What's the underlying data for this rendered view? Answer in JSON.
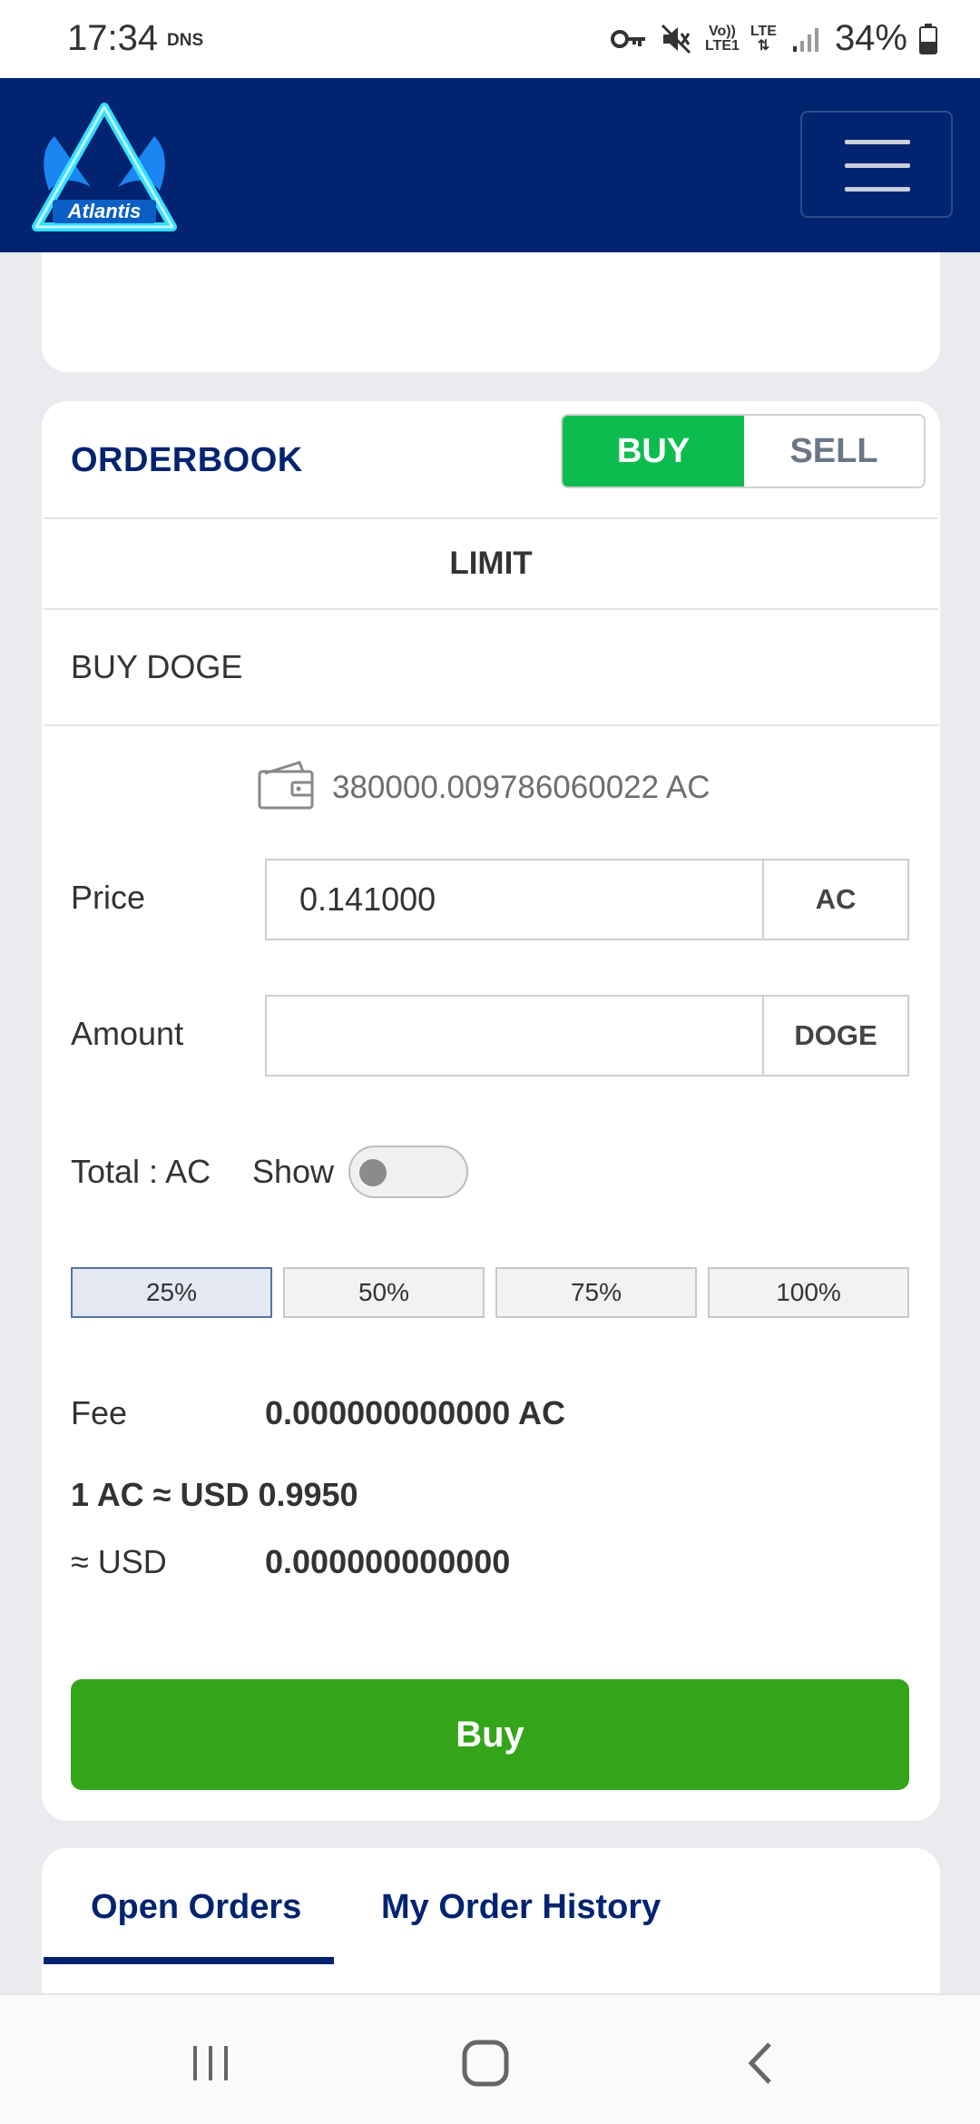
{
  "status_bar": {
    "time": "17:34",
    "carrier": "DNS",
    "volte_line1": "Vo))",
    "volte_line2": "LTE1",
    "lte_label": "LTE",
    "battery": "34%"
  },
  "header": {
    "logo_text": "Atlantis",
    "menu_icon": "hamburger-icon"
  },
  "orderbook": {
    "title": "ORDERBOOK",
    "buy_tab": "BUY",
    "sell_tab": "SELL",
    "order_type": "LIMIT",
    "pair_title": "BUY DOGE",
    "wallet_balance": "380000.009786060022 AC",
    "price_label": "Price",
    "price_value": "0.141000",
    "price_unit": "AC",
    "amount_label": "Amount",
    "amount_value": "",
    "amount_unit": "DOGE",
    "total_label": "Total : AC",
    "show_label": "Show",
    "show_toggle_on": false,
    "percent_buttons": [
      "25%",
      "50%",
      "75%",
      "100%"
    ],
    "selected_percent": "25%",
    "fee_label": "Fee",
    "fee_value": "0.000000000000 AC",
    "rate_text": "1 AC ≈ USD 0.9950",
    "usd_label": "≈ USD",
    "usd_value": "0.000000000000",
    "submit_label": "Buy"
  },
  "orders_tabs": {
    "open_orders": "Open Orders",
    "history": "My Order History",
    "active": "Open Orders"
  },
  "colors": {
    "header_bg": "#022470",
    "buy_green": "#0cbc4f",
    "submit_green": "#34a51a",
    "page_bg": "#e9ebee"
  }
}
